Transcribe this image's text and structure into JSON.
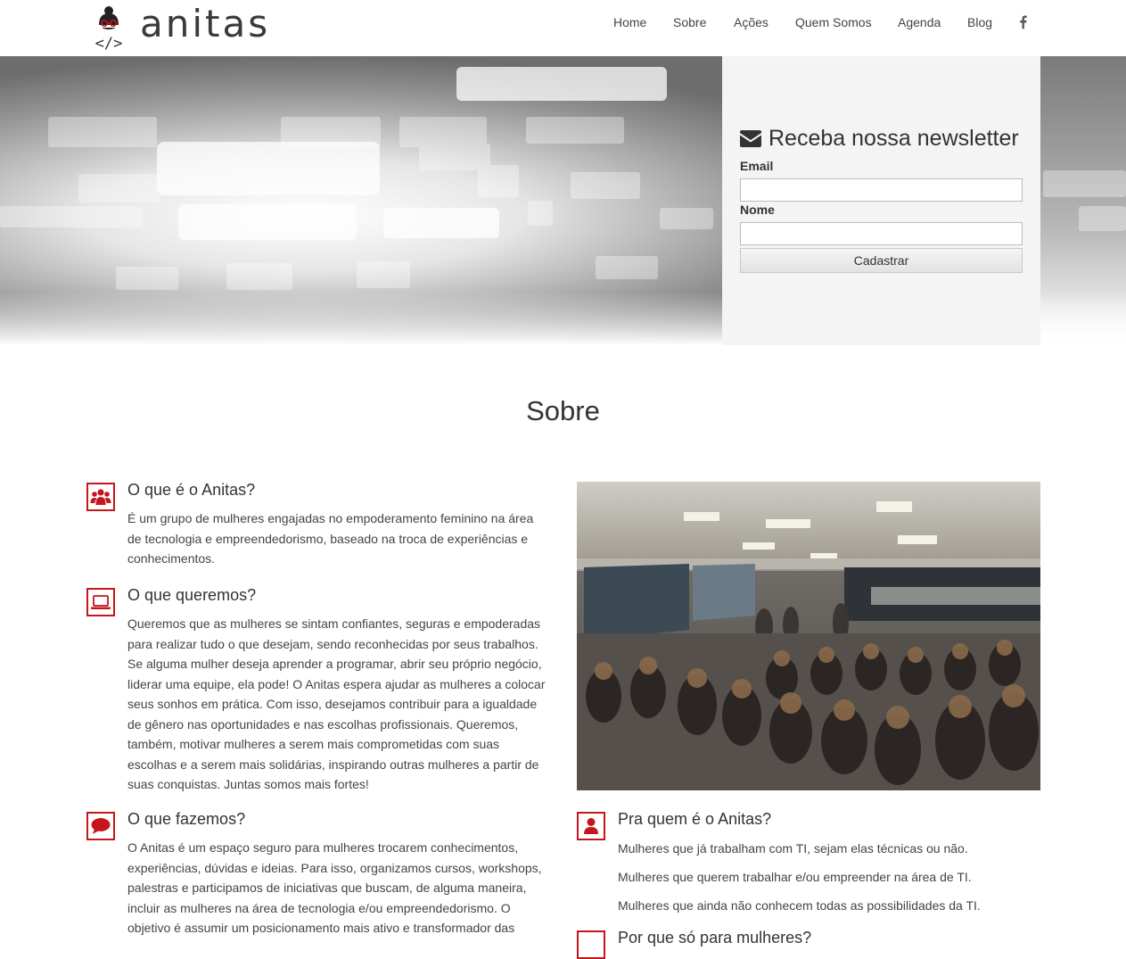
{
  "brand": {
    "name": "anitas",
    "accent": "#c4161c"
  },
  "nav": {
    "items": [
      "Home",
      "Sobre",
      "Ações",
      "Quem Somos",
      "Agenda",
      "Blog"
    ],
    "social_icon": "facebook-icon"
  },
  "newsletter": {
    "title": "Receba nossa newsletter",
    "icon": "envelope-icon",
    "email_label": "Email",
    "email_value": "",
    "name_label": "Nome",
    "name_value": "",
    "submit_label": "Cadastrar"
  },
  "sobre": {
    "title": "Sobre",
    "items": [
      {
        "icon": "users-icon",
        "title": "O que é o Anitas?",
        "text": "É um grupo de mulheres engajadas no empoderamento feminino na área de tecnologia e empreendedorismo, baseado na troca de experiências e conhecimentos."
      },
      {
        "icon": "laptop-icon",
        "title": "O que queremos?",
        "text": "Queremos que as mulheres se sintam confiantes, seguras e empoderadas para realizar tudo o que desejam, sendo reconhecidas por seus trabalhos. Se alguma mulher deseja aprender a programar, abrir seu próprio negócio, liderar uma equipe, ela pode! O Anitas espera ajudar as mulheres a colocar seus sonhos em prática. Com isso, desejamos contribuir para a igualdade de gênero nas oportunidades e nas escolhas profissionais. Queremos, também, motivar mulheres a serem mais comprometidas com suas escolhas e a serem mais solidárias, inspirando outras mulheres a partir de suas conquistas. Juntas somos mais fortes!"
      },
      {
        "icon": "speech-bubble-icon",
        "title": "O que fazemos?",
        "text": "O Anitas é um espaço seguro para mulheres trocarem conhecimentos, experiências, dúvidas e ideias. Para isso, organizamos cursos, workshops, palestras e participamos de iniciativas que buscam, de alguma maneira, incluir as mulheres na área de tecnologia e/ou empreendedorismo. O objetivo é assumir um posicionamento mais ativo e transformador das"
      }
    ],
    "audience": {
      "icon": "user-icon",
      "title": "Pra quem é o Anitas?",
      "lines": [
        "Mulheres que já trabalham com TI, sejam elas técnicas ou não.",
        "Mulheres que querem trabalhar e/ou empreender na área de TI.",
        "Mulheres que ainda não conhecem todas as possibilidades da TI."
      ]
    },
    "next_item_title": "Por que só para mulheres?"
  }
}
